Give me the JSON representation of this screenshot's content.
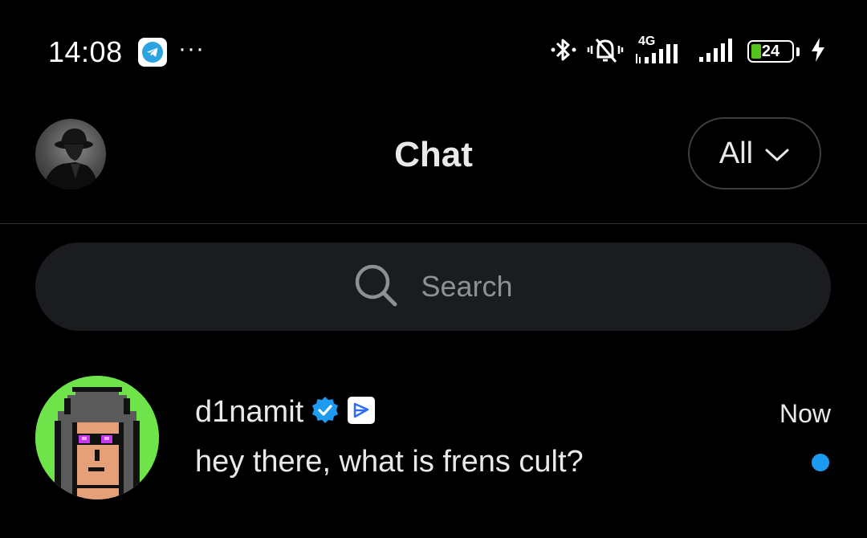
{
  "status_bar": {
    "time": "14:08",
    "more": "···",
    "network_label": "4G",
    "battery_level": "24"
  },
  "header": {
    "title": "Chat",
    "filter_label": "All"
  },
  "search": {
    "placeholder": "Search"
  },
  "conversations": [
    {
      "name": "d1namit",
      "time": "Now",
      "message": "hey there, what is frens cult?",
      "verified": true,
      "unread": true
    }
  ],
  "colors": {
    "background": "#000000",
    "accent": "#1d9bf0",
    "search_bg": "#1a1c1f",
    "battery": "#52c41a",
    "avatar_bg": "#6fe34a"
  }
}
